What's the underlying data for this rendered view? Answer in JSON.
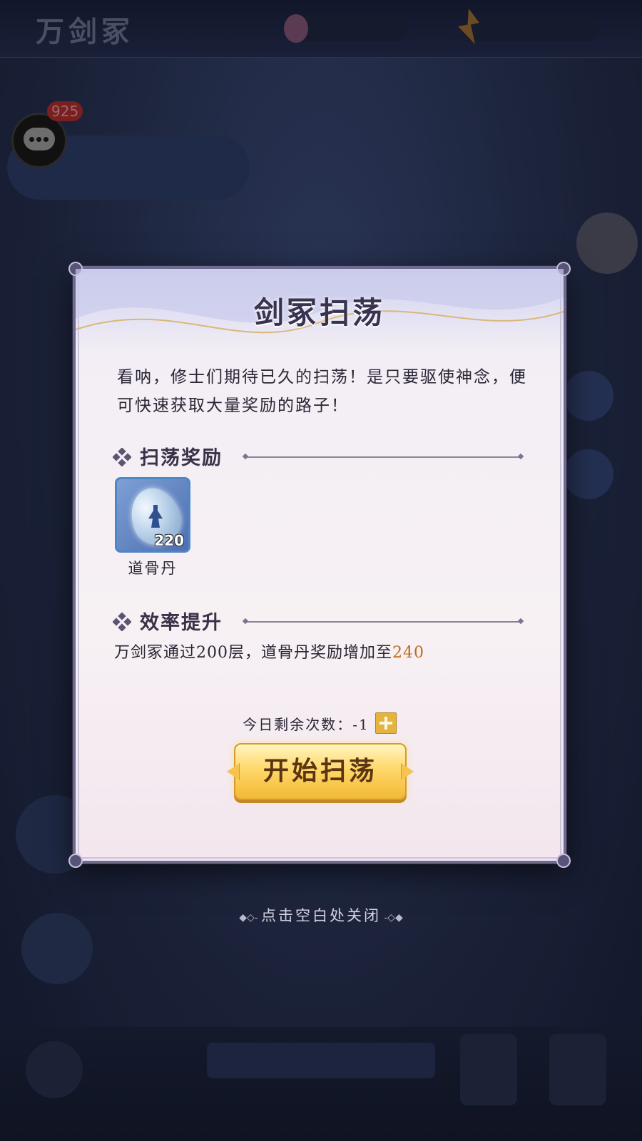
{
  "modal": {
    "title": "剑冢扫荡",
    "intro": "看呐，修士们期待已久的扫荡！是只要驱使神念，便可快速获取大量奖励的路子！",
    "rewards_section": {
      "label": "扫荡奖励",
      "items": [
        {
          "name": "道骨丹",
          "count": "220",
          "icon": "dao-bone-pill-icon"
        }
      ]
    },
    "efficiency_section": {
      "label": "效率提升",
      "text_prefix": "万剑冢通过200层，道骨丹奖励增加至",
      "highlight_value": "240"
    },
    "remaining": {
      "label": "今日剩余次数：",
      "value": "-1"
    },
    "start_button": "开始扫荡"
  },
  "close_hint": "点击空白处关闭",
  "colors": {
    "highlight": "#c06a1a",
    "button_gold": "#ffd86a",
    "frame": "#6f6b90"
  }
}
